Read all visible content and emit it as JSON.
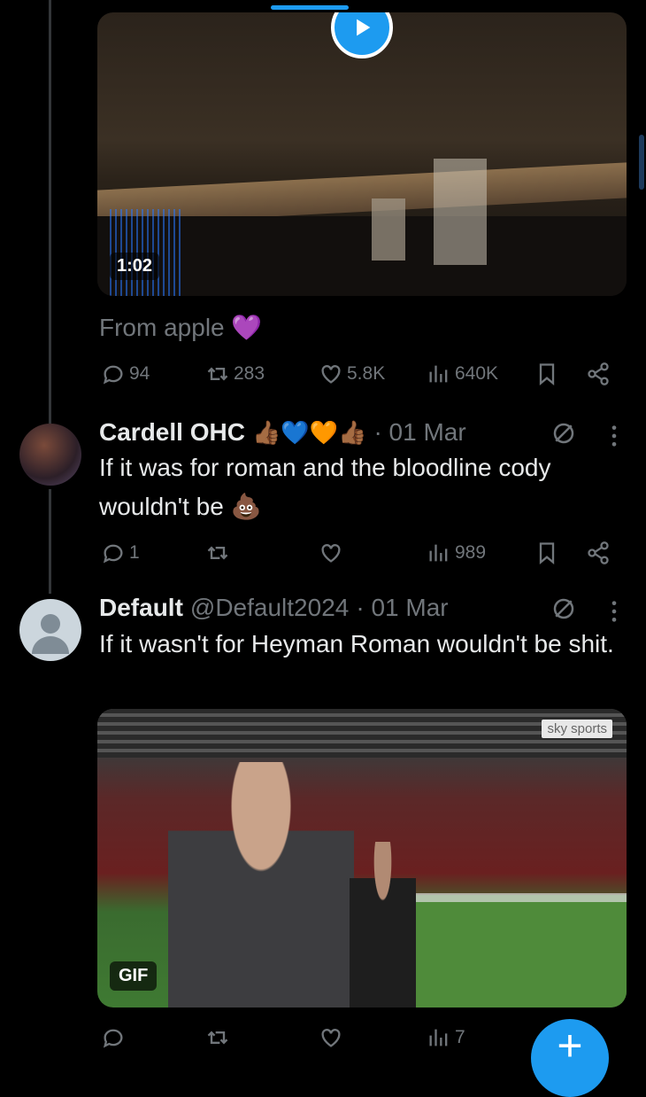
{
  "tweet1": {
    "video_duration": "1:02",
    "caption": "From apple",
    "caption_emoji": "💜",
    "replies": "94",
    "retweets": "283",
    "likes": "5.8K",
    "views": "640K"
  },
  "reply1": {
    "name": "Cardell OHC",
    "name_emojis": "👍🏾💙🧡👍🏾",
    "date": "· 01 Mar",
    "text": "If it was for roman and the bloodline cody wouldn't be",
    "text_emoji": "💩",
    "replies": "1",
    "views": "989"
  },
  "reply2": {
    "name": "Default",
    "handle": "@Default2024",
    "date": "· 01 Mar",
    "text": "If it wasn't for Heyman Roman wouldn't be shit.",
    "gif_badge": "GIF",
    "gif_watermark": "sky sports",
    "views": "7"
  },
  "fab": {
    "label": "+"
  },
  "colors": {
    "accent": "#1d9bf0",
    "muted": "#71767b",
    "background": "#000000"
  }
}
